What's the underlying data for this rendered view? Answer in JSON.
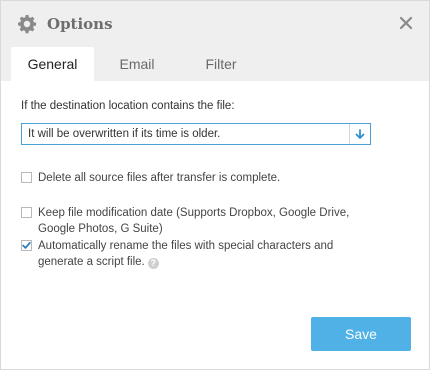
{
  "dialog": {
    "title": "Options",
    "close_icon": "close-icon",
    "title_icon": "gear-icon"
  },
  "tabs": [
    {
      "label": "General",
      "active": true
    },
    {
      "label": "Email",
      "active": false
    },
    {
      "label": "Filter",
      "active": false
    }
  ],
  "general": {
    "question": "If the destination location contains the file:",
    "select": {
      "value": "It will be overwritten if its time is older.",
      "arrow_icon": "arrow-down-icon"
    },
    "options": [
      {
        "label": "Delete all source files after transfer is complete.",
        "checked": false
      },
      {
        "label": "Keep file modification date (Supports Dropbox, Google Drive, Google Photos, G Suite)",
        "checked": false
      },
      {
        "label": "Automatically rename the files with special characters and generate a script file.",
        "checked": true,
        "help_icon": "help-icon",
        "help_glyph": "?"
      }
    ]
  },
  "footer": {
    "save_label": "Save"
  },
  "colors": {
    "accent": "#4fb1e5",
    "header_bg": "#efefef",
    "select_border": "#4a9fd5"
  }
}
